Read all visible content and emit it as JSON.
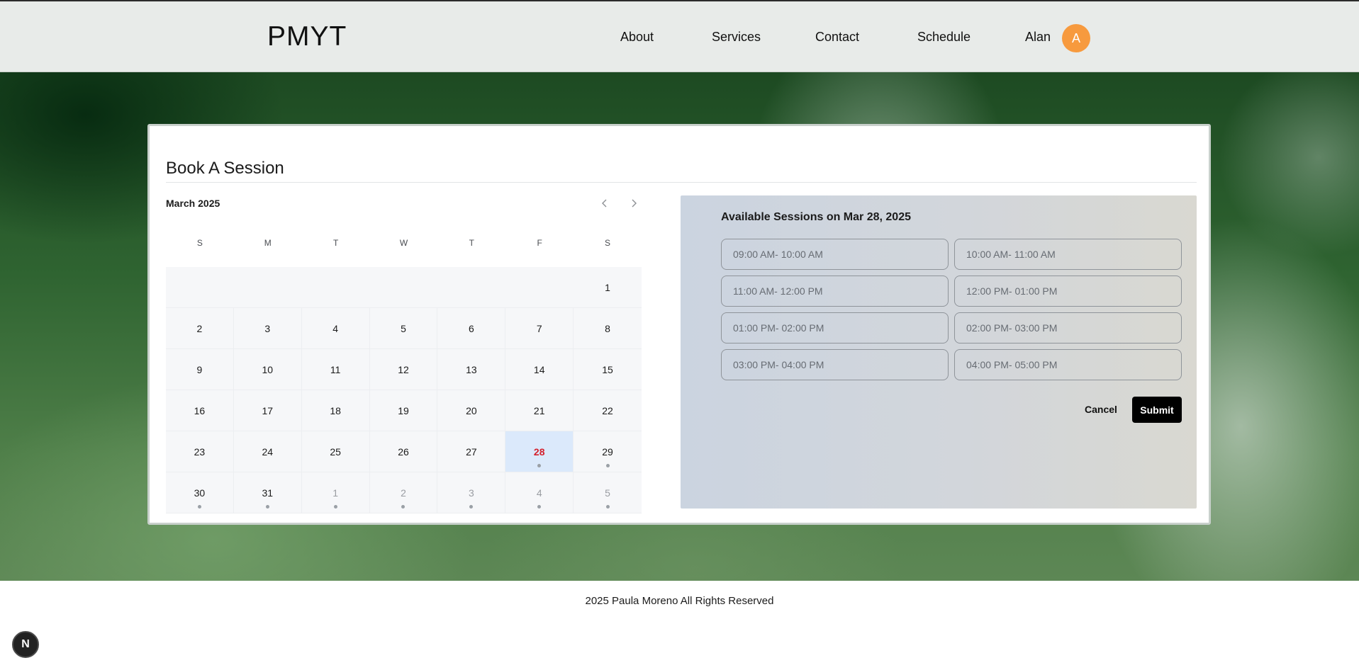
{
  "header": {
    "logo": "PMYT",
    "nav": {
      "about": "About",
      "services": "Services",
      "contact": "Contact",
      "schedule": "Schedule"
    },
    "user_name": "Alan",
    "avatar_initial": "A"
  },
  "booking": {
    "title": "Book A Session",
    "calendar": {
      "month_label": "March 2025",
      "weekdays": [
        "S",
        "M",
        "T",
        "W",
        "T",
        "F",
        "S"
      ],
      "weeks": [
        [
          {
            "d": ""
          },
          {
            "d": ""
          },
          {
            "d": ""
          },
          {
            "d": ""
          },
          {
            "d": ""
          },
          {
            "d": ""
          },
          {
            "d": "1"
          }
        ],
        [
          {
            "d": "2"
          },
          {
            "d": "3"
          },
          {
            "d": "4"
          },
          {
            "d": "5"
          },
          {
            "d": "6"
          },
          {
            "d": "7"
          },
          {
            "d": "8"
          }
        ],
        [
          {
            "d": "9"
          },
          {
            "d": "10"
          },
          {
            "d": "11"
          },
          {
            "d": "12"
          },
          {
            "d": "13"
          },
          {
            "d": "14"
          },
          {
            "d": "15"
          }
        ],
        [
          {
            "d": "16"
          },
          {
            "d": "17"
          },
          {
            "d": "18"
          },
          {
            "d": "19"
          },
          {
            "d": "20"
          },
          {
            "d": "21"
          },
          {
            "d": "22"
          }
        ],
        [
          {
            "d": "23"
          },
          {
            "d": "24"
          },
          {
            "d": "25"
          },
          {
            "d": "26"
          },
          {
            "d": "27"
          },
          {
            "d": "28",
            "selected": true,
            "dot": true
          },
          {
            "d": "29",
            "dot": true
          }
        ],
        [
          {
            "d": "30",
            "dot": true
          },
          {
            "d": "31",
            "dot": true
          },
          {
            "d": "1",
            "muted": true,
            "dot": true
          },
          {
            "d": "2",
            "muted": true,
            "dot": true
          },
          {
            "d": "3",
            "muted": true,
            "dot": true
          },
          {
            "d": "4",
            "muted": true,
            "dot": true
          },
          {
            "d": "5",
            "muted": true,
            "dot": true
          }
        ]
      ]
    },
    "sessions": {
      "title": "Available Sessions on Mar 28, 2025",
      "slots": [
        "09:00 AM- 10:00 AM",
        "10:00 AM- 11:00 AM",
        "11:00 AM- 12:00 PM",
        "12:00 PM- 01:00 PM",
        "01:00 PM- 02:00 PM",
        "02:00 PM- 03:00 PM",
        "03:00 PM- 04:00 PM",
        "04:00 PM- 05:00 PM"
      ],
      "cancel_label": "Cancel",
      "submit_label": "Submit"
    }
  },
  "footer": {
    "text": "2025 Paula Moreno All Rights Reserved",
    "badge": "N"
  },
  "colors": {
    "accent_avatar": "#f79a3e",
    "selected_day_bg": "#dbe9fb",
    "selected_day_text": "#d4202c",
    "submit_bg": "#000000"
  }
}
